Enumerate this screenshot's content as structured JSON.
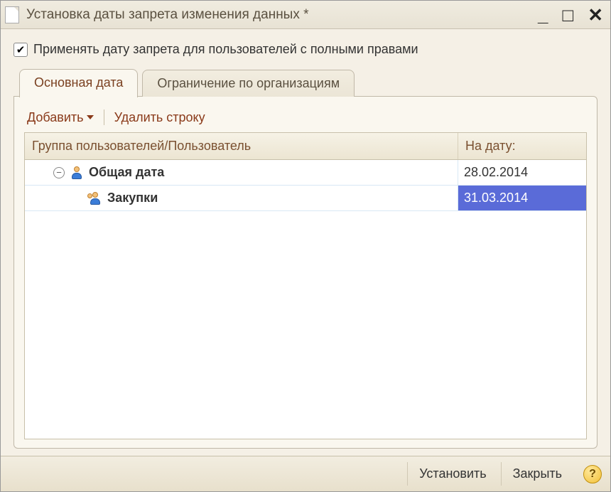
{
  "window": {
    "title": "Установка даты запрета изменения данных  *"
  },
  "checkbox": {
    "checked": true,
    "label": "Применять дату запрета для пользователей с полными правами"
  },
  "tabs": {
    "main": "Основная дата",
    "orgs": "Ограничение по организациям"
  },
  "toolbar": {
    "add": "Добавить",
    "delete": "Удалить строку"
  },
  "grid": {
    "columns": {
      "group": "Группа пользователей/Пользователь",
      "date": "На дату:"
    },
    "rows": [
      {
        "label": "Общая дата",
        "date": "28.02.2014",
        "level": 1,
        "bold": true,
        "expander": true,
        "iconType": "single"
      },
      {
        "label": "Закупки",
        "date": "31.03.2014",
        "level": 2,
        "bold": true,
        "selected": true,
        "iconType": "group"
      }
    ]
  },
  "footer": {
    "apply": "Установить",
    "close": "Закрыть"
  }
}
